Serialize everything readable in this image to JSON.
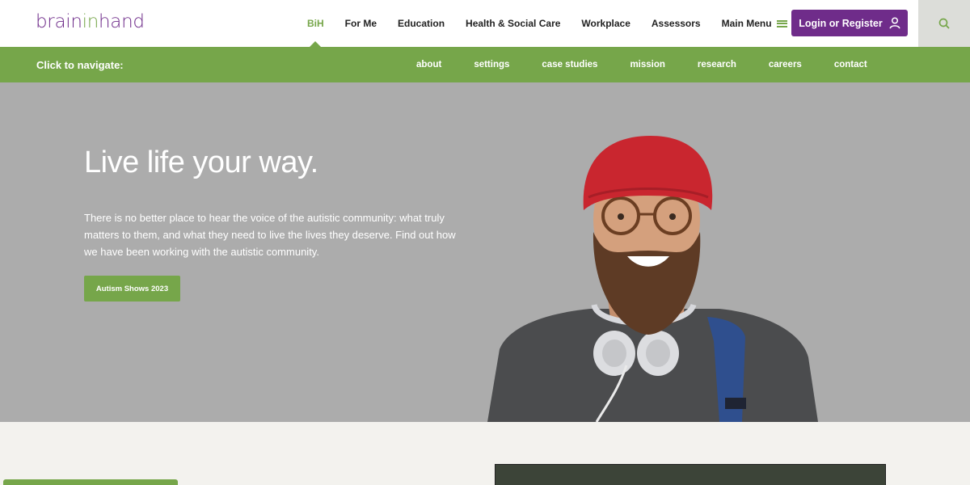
{
  "header": {
    "logo": {
      "part1": "brain",
      "part2": "in",
      "part3": "hand"
    },
    "nav": [
      {
        "label": "BiH",
        "active": true
      },
      {
        "label": "For Me"
      },
      {
        "label": "Education"
      },
      {
        "label": "Health & Social Care"
      },
      {
        "label": "Workplace"
      },
      {
        "label": "Assessors"
      },
      {
        "label": "Main Menu",
        "icon": "menu-icon"
      }
    ],
    "login_label": "Login or Register",
    "login_icon": "user-icon",
    "search_icon": "search-icon"
  },
  "subnav": {
    "label": "Click to navigate:",
    "links": [
      "about",
      "settings",
      "case studies",
      "mission",
      "research",
      "careers",
      "contact"
    ]
  },
  "hero": {
    "title": "Live life your way.",
    "text": "There is no better place to hear the voice of the autistic community: what truly matters to them, and what they need to live the lives they deserve. Find out how we have been working with the autistic community.",
    "button": "Autism Shows 2023"
  },
  "colors": {
    "brand_purple": "#6f2c8a",
    "brand_green": "#76a64a",
    "hero_bg": "#acacac",
    "page_bg": "#f3f2ee"
  }
}
